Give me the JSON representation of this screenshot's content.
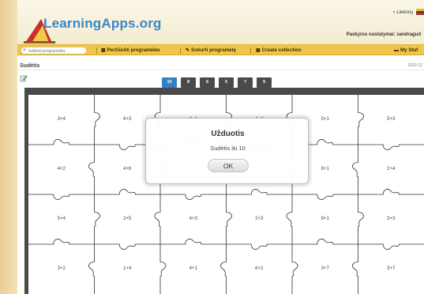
{
  "header": {
    "site_name": "LearningApps.org",
    "language": "Lietuvių",
    "account_text": "Paskyros nustatymai: sandragud"
  },
  "nav": {
    "search_placeholder": "Ieškoti programėlių",
    "browse_label": "Peržiūrėti programėles",
    "create_label": "Sukurti programėlę",
    "collection_label": "Create collection",
    "my_apps_label": "My Stuf"
  },
  "app": {
    "title": "Sudėtis",
    "date": "2022-12"
  },
  "tabs": [
    "10",
    "8",
    "6",
    "5",
    "7",
    "9"
  ],
  "active_tab": "10",
  "grid": {
    "rows": [
      [
        "3+4",
        "6+3",
        "8+1",
        "4+4",
        "5+1",
        "5+3"
      ],
      [
        "4+2",
        "4+6",
        "",
        "",
        "6+1",
        "2+4"
      ],
      [
        "5+4",
        "2+5",
        "4+3",
        "2+3",
        "9+1",
        "3+3"
      ],
      [
        "3+2",
        "1+4",
        "4+1",
        "6+2",
        "3+7",
        "3+7"
      ]
    ]
  },
  "dialog": {
    "title": "Užduotis",
    "text": "Sudėtis iki 10",
    "ok_label": "OK"
  },
  "colors": {
    "accent_blue": "#2f80c6",
    "nav_yellow": "#f0c54a",
    "board_dark": "#4a4a4a"
  }
}
